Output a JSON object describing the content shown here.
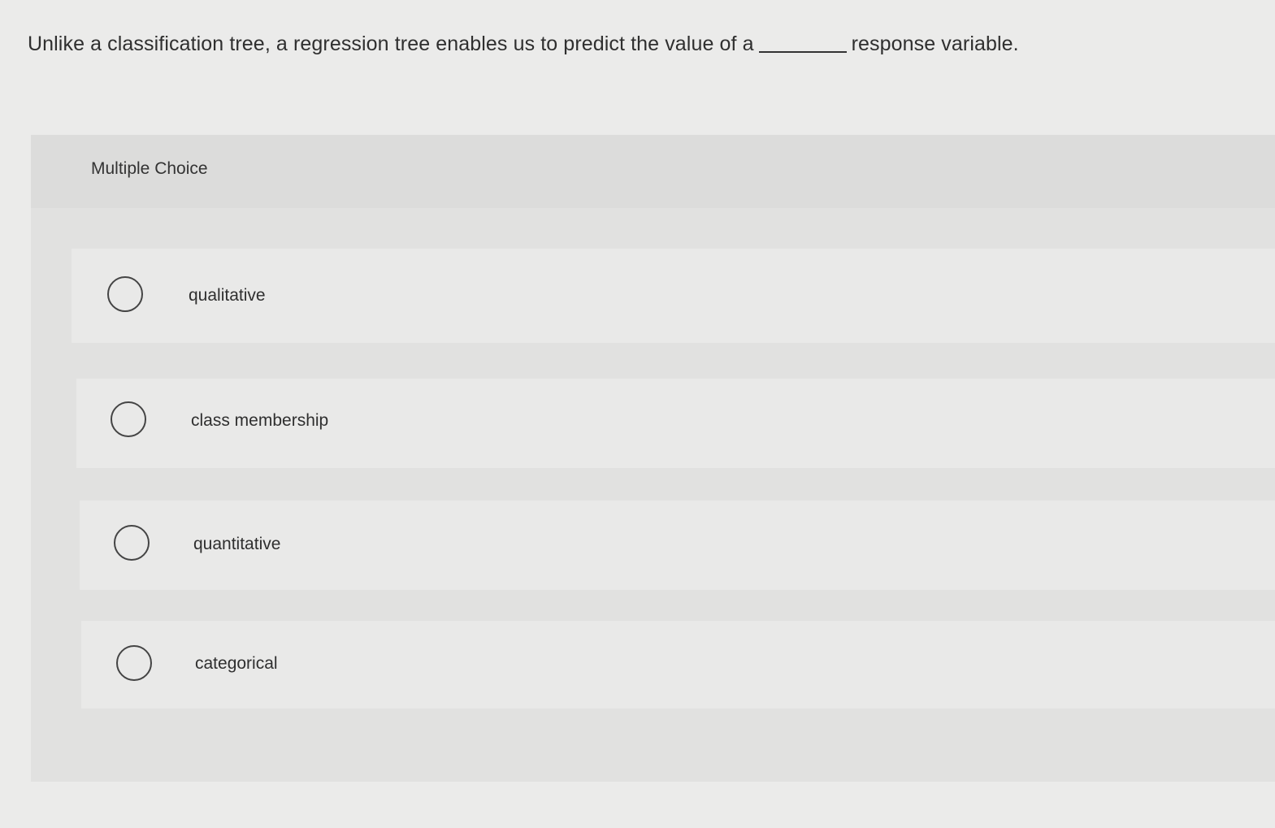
{
  "question": {
    "text_before": "Unlike a classification tree, a regression tree enables us to predict the value of a",
    "text_after": "response variable."
  },
  "panel": {
    "title": "Multiple Choice"
  },
  "choices": [
    {
      "label": "qualitative",
      "selected": false
    },
    {
      "label": "class membership",
      "selected": false
    },
    {
      "label": "quantitative",
      "selected": false
    },
    {
      "label": "categorical",
      "selected": false
    }
  ]
}
